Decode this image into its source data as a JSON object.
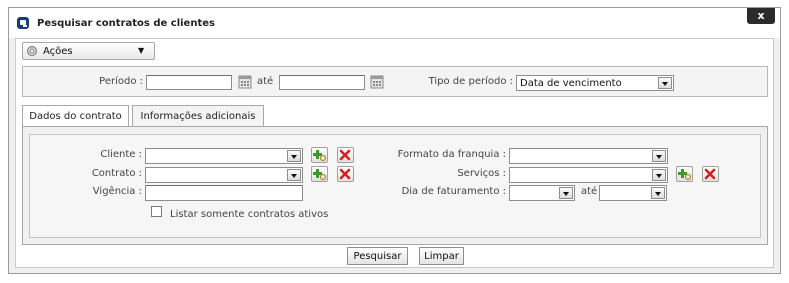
{
  "dialog": {
    "title": "Pesquisar contratos de clientes",
    "close_label": "x"
  },
  "actions": {
    "label": "Ações"
  },
  "period": {
    "label": "Período :",
    "until": "até",
    "type_label": "Tipo de período :",
    "type_value": "Data de vencimento"
  },
  "tabs": [
    {
      "label": "Dados do contrato",
      "active": true
    },
    {
      "label": "Informações adicionais",
      "active": false
    }
  ],
  "form": {
    "cliente": "Cliente :",
    "contrato": "Contrato :",
    "vigencia": "Vigência :",
    "formato_franquia": "Formato da franquia :",
    "servicos": "Serviços :",
    "dia_faturamento": "Dia de faturamento :",
    "dia_ate": "até",
    "only_active": "Listar somente contratos ativos"
  },
  "buttons": {
    "search": "Pesquisar",
    "clear": "Limpar"
  },
  "colors": {
    "close_bg": "#2b2b2b",
    "add_icon": "#3a9a2a",
    "remove_icon": "#d42020"
  },
  "icons": {
    "title": "dialog-icon",
    "actions": "gear-icon",
    "add": "add-icon",
    "remove": "remove-icon",
    "calendar": "calendar-icon"
  }
}
